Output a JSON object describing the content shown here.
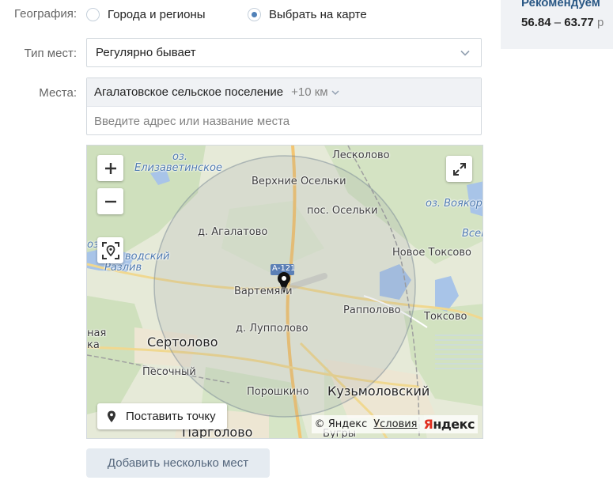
{
  "geography": {
    "label": "География:",
    "options": [
      {
        "label": "Города и регионы",
        "selected": false
      },
      {
        "label": "Выбрать на карте",
        "selected": true
      }
    ]
  },
  "place_type": {
    "label": "Тип мест:",
    "value": "Регулярно бывает"
  },
  "places": {
    "label": "Места:",
    "token": "Агалатовское сельское поселение",
    "radius": "+10 км",
    "placeholder": "Введите адрес или название места"
  },
  "map": {
    "labels": {
      "leskolovo": "Лесколово",
      "elizavetinskoe": "Елизаветинское",
      "oz_elizavetinskoe": "оз.",
      "verkhnie_oselki": "Верхние Осельки",
      "oz_voyakor": "оз. Воякор",
      "pos_oselki": "пос. Осельки",
      "agalatovo": "д. Агалатово",
      "vsev": "Всев",
      "razliv_oz": "оз.",
      "vodskiy": "водский",
      "razliv": "Разлив",
      "novoe_toksovo": "Новое Токсово",
      "road": "А-121",
      "vartemyagi": "Вартемяги",
      "rappolovo": "Рапполово",
      "toksovo": "Токсово",
      "luppolovo": "д. Лупполово",
      "ndaya": "ная",
      "sertolovo": "Сертолово",
      "ka": "ка",
      "pesochny": "Песочный",
      "kuzmolovskiy": "Кузьмоловский",
      "poroshkino": "Порошкино",
      "pargolovo": "Парголово",
      "bugry": "Бугры"
    },
    "place_point_label": "Поставить точку",
    "copyright": "© Яндекс",
    "terms": "Условия",
    "brand_y": "Я",
    "brand_rest": "ндекс"
  },
  "add_button": "Добавить несколько мест",
  "side": {
    "title": "Рекомендуем",
    "range_from": "56.84",
    "dash": "–",
    "range_to": "63.77",
    "currency": "р"
  },
  "colors": {
    "accent": "#5181b8",
    "link": "#2a5885",
    "button_bg": "#e5ebf1"
  }
}
